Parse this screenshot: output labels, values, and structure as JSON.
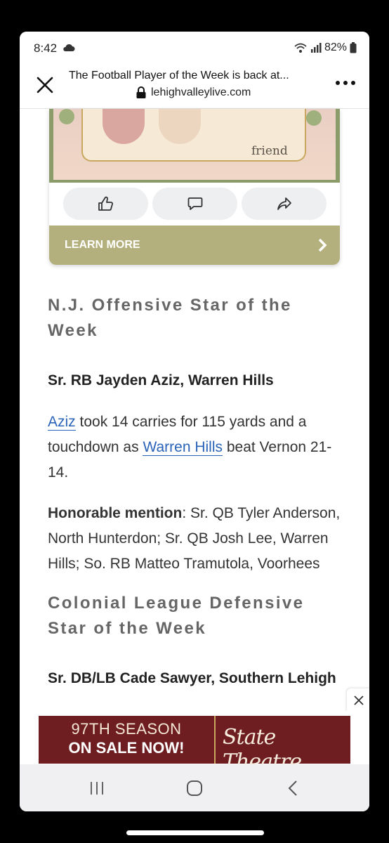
{
  "status_bar": {
    "time": "8:42",
    "battery": "82%",
    "icons": [
      "cloud-icon",
      "wifi-icon",
      "signal-icon",
      "battery-icon"
    ]
  },
  "browser": {
    "title": "The Football Player of the Week is back at...",
    "url": "lehighvalleylive.com",
    "icons": [
      "close-icon",
      "lock-icon",
      "more-icon"
    ]
  },
  "ad": {
    "image_text": "friend",
    "actions": [
      "thumbs-up-icon",
      "comment-icon",
      "share-icon"
    ],
    "cta": "LEARN MORE",
    "colors": {
      "cta_bg": "#b4b07d",
      "frame": "#8c9b6a"
    }
  },
  "article": {
    "section1": {
      "heading": "N.J. Offensive Star of the Week",
      "player": "Sr. RB Jayden Aziz, Warren Hills",
      "para_link1": "Aziz",
      "para_text1": " took 14 carries for 115 yards and a touchdown as ",
      "para_link2": "Warren Hills",
      "para_text2": " beat Vernon 21-14.",
      "hm_label": "Honorable mention",
      "hm_text": ": Sr. QB Tyler Anderson, North Hunterdon; Sr. QB Josh Lee, Warren Hills; So. RB Matteo Tramutola, Voorhees"
    },
    "section2": {
      "heading": "Colonial League Defensive Star of the Week",
      "player": "Sr. DB/LB Cade Sawyer, Southern Lehigh"
    },
    "colors": {
      "link": "#2a63b8",
      "heading": "#666666"
    }
  },
  "banner": {
    "line1": "97TH SEASON",
    "line2": "ON SALE NOW!",
    "logo": "State Theatre",
    "colors": {
      "bg": "#6e1e21",
      "accent": "#c9a760"
    }
  },
  "navbar": {
    "items": [
      "recents-icon",
      "home-icon",
      "back-icon"
    ]
  }
}
